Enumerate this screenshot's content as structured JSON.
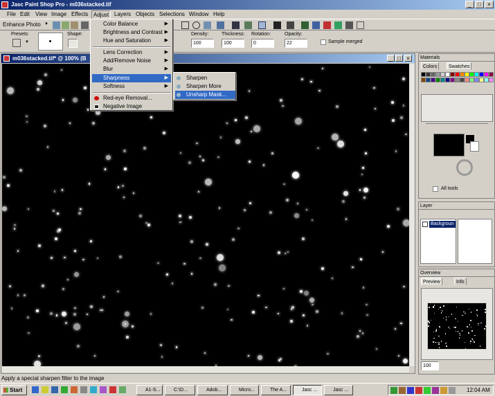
{
  "window": {
    "title": "Jasc Paint Shop Pro - m036stacked.tif"
  },
  "menubar": [
    "File",
    "Edit",
    "View",
    "Image",
    "Effects",
    "Adjust",
    "Layers",
    "Objects",
    "Selections",
    "Window",
    "Help"
  ],
  "toolbar": {
    "enhance_photo": "Enhance Photo"
  },
  "tool_options": {
    "presets_label": "Presets:",
    "shape_label": "Shape:",
    "density_label": "Density:",
    "density_value": "100",
    "thickness_label": "Thickness:",
    "thickness_value": "100",
    "rotation_label": "Rotation:",
    "rotation_value": "0",
    "opacity_label": "Opacity:",
    "opacity_value": "22",
    "sample_merged_label": "Sample merged"
  },
  "document": {
    "title": "m036stacked.tif* @ 100% (B"
  },
  "adjust_menu": [
    "Color Balance",
    "Brightness and Contrast",
    "Hue and Saturation",
    "Lens Correction",
    "Add/Remove Noise",
    "Blur",
    "Sharpness",
    "Softness",
    "Red-eye Removal...",
    "Negative Image"
  ],
  "sharpness_submenu": [
    "Sharpen",
    "Sharpen More",
    "Unsharp Mask..."
  ],
  "materials": {
    "title": "Materials",
    "tab_colors": "Colors",
    "tab_swatches": "Swatches",
    "all_tools": "All tools"
  },
  "layer": {
    "title": "Layer",
    "item": "Backgroun"
  },
  "overview": {
    "title": "Overview",
    "tab_preview": "Preview",
    "tab_info": "Info",
    "zoom": "100"
  },
  "status_text": "Apply a special sharpen filter to the image",
  "taskbar": {
    "start": "Start",
    "tasks": [
      "A1-S...",
      "C:\\D...",
      "Adob...",
      "Micro...",
      "The A...",
      "Jasc ...",
      "Jasc ..."
    ],
    "clock": "12:04 AM"
  },
  "colors": {
    "accent": "#0a246a",
    "highlight": "#316ac5"
  }
}
